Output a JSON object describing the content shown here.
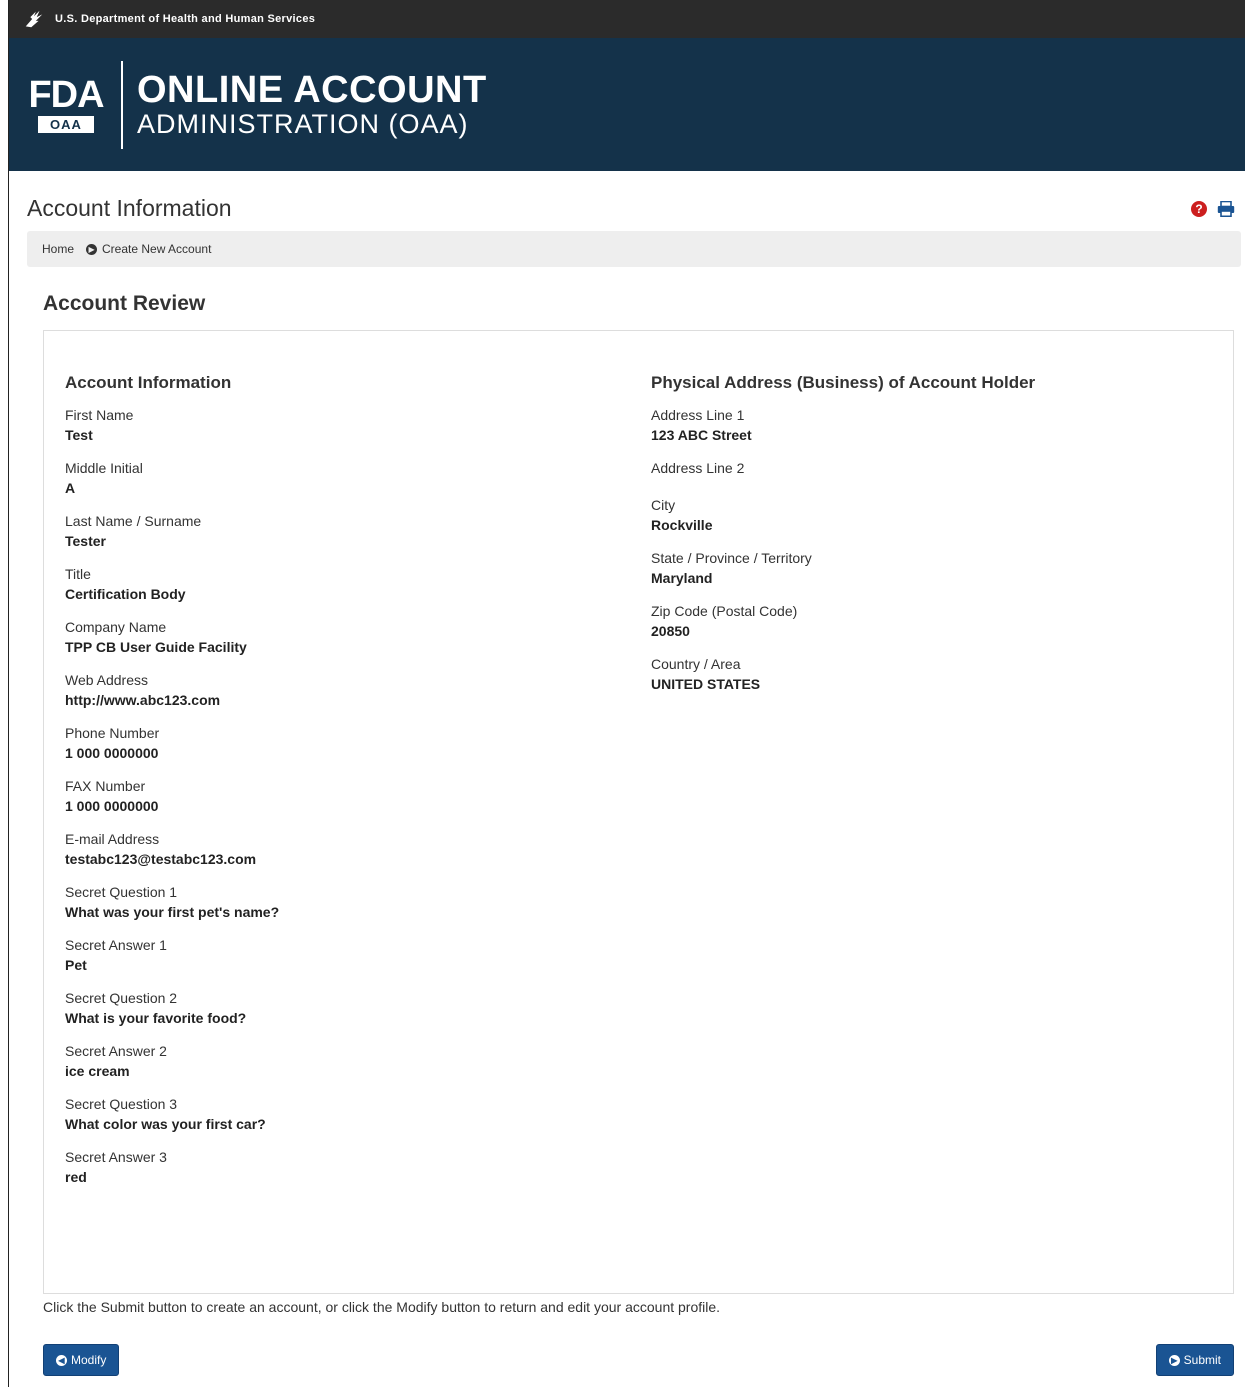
{
  "hhs_bar": {
    "text": "U.S. Department of Health and Human Services"
  },
  "banner": {
    "logo_top": "FDA",
    "logo_badge": "OAA",
    "title_line1": "ONLINE ACCOUNT",
    "title_line2": "ADMINISTRATION (OAA)"
  },
  "page": {
    "title": "Account Information",
    "help_icon": "question-circle-icon",
    "print_icon": "print-icon"
  },
  "breadcrumb": {
    "items": [
      "Home",
      "Create New Account"
    ]
  },
  "review": {
    "title": "Account Review",
    "account_section": {
      "title": "Account Information",
      "fields": [
        {
          "label": "First Name",
          "value": "Test"
        },
        {
          "label": "Middle Initial",
          "value": "A"
        },
        {
          "label": "Last Name / Surname",
          "value": "Tester"
        },
        {
          "label": "Title",
          "value": "Certification Body"
        },
        {
          "label": "Company Name",
          "value": "TPP CB User Guide Facility"
        },
        {
          "label": "Web Address",
          "value": "http://www.abc123.com"
        },
        {
          "label": "Phone Number",
          "value": "1 000 0000000"
        },
        {
          "label": "FAX Number",
          "value": "1 000 0000000"
        },
        {
          "label": "E-mail Address",
          "value": "testabc123@testabc123.com"
        },
        {
          "label": "Secret Question 1",
          "value": "What was your first pet's name?"
        },
        {
          "label": "Secret Answer 1",
          "value": "Pet"
        },
        {
          "label": "Secret Question 2",
          "value": "What is your favorite food?"
        },
        {
          "label": "Secret Answer 2",
          "value": "ice cream"
        },
        {
          "label": "Secret Question 3",
          "value": "What color was your first car?"
        },
        {
          "label": "Secret Answer 3",
          "value": "red"
        }
      ]
    },
    "address_section": {
      "title": "Physical Address (Business) of Account Holder",
      "fields": [
        {
          "label": "Address Line 1",
          "value": "123 ABC Street"
        },
        {
          "label": "Address Line 2",
          "value": ""
        },
        {
          "label": "City",
          "value": "Rockville"
        },
        {
          "label": "State / Province / Territory",
          "value": "Maryland"
        },
        {
          "label": "Zip Code (Postal Code)",
          "value": "20850"
        },
        {
          "label": "Country / Area",
          "value": "UNITED STATES"
        }
      ]
    }
  },
  "instructions": "Click the Submit button to create an account, or click the Modify button to return and edit your account profile.",
  "buttons": {
    "modify": "Modify",
    "submit": "Submit"
  },
  "colors": {
    "banner": "#14324a",
    "hhs_bar": "#2b2b2b",
    "button": "#1a5493",
    "help": "#cc1f1f"
  }
}
